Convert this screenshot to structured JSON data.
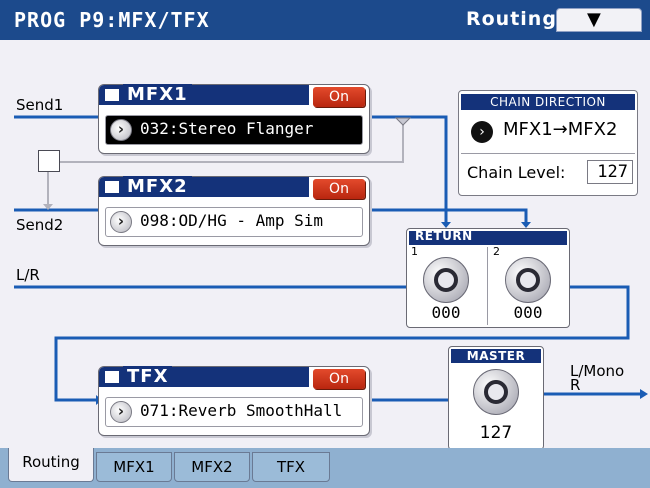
{
  "header": {
    "title": "PROG P9:MFX/TFX",
    "page_name": "Routing",
    "menu_icon": "chevron-down-icon"
  },
  "routing": {
    "send1": "Send1",
    "send2": "Send2",
    "lr": "L/R",
    "out_lmono": "L/Mono",
    "out_r": "R"
  },
  "mfx1": {
    "name": "MFX1",
    "on_label": "On",
    "effect": "032:Stereo Flanger"
  },
  "mfx2": {
    "name": "MFX2",
    "on_label": "On",
    "effect": "098:OD/HG - Amp Sim"
  },
  "tfx": {
    "name": "TFX",
    "on_label": "On",
    "effect": "071:Reverb SmoothHall"
  },
  "chain": {
    "header": "CHAIN DIRECTION",
    "direction": "MFX1→MFX2",
    "level_label": "Chain Level:",
    "level_value": "127"
  },
  "return": {
    "header": "RETURN",
    "knob1_num": "1",
    "knob1_value": "000",
    "knob2_num": "2",
    "knob2_value": "000"
  },
  "master": {
    "header": "MASTER",
    "value": "127"
  },
  "tabs": [
    "Routing",
    "MFX1",
    "MFX2",
    "TFX"
  ],
  "colors": {
    "header_bg": "#1c4a8c",
    "routing_line": "#1a5cb4",
    "on_button": "#d23a1c",
    "tab_bar": "#8fb0d0"
  }
}
